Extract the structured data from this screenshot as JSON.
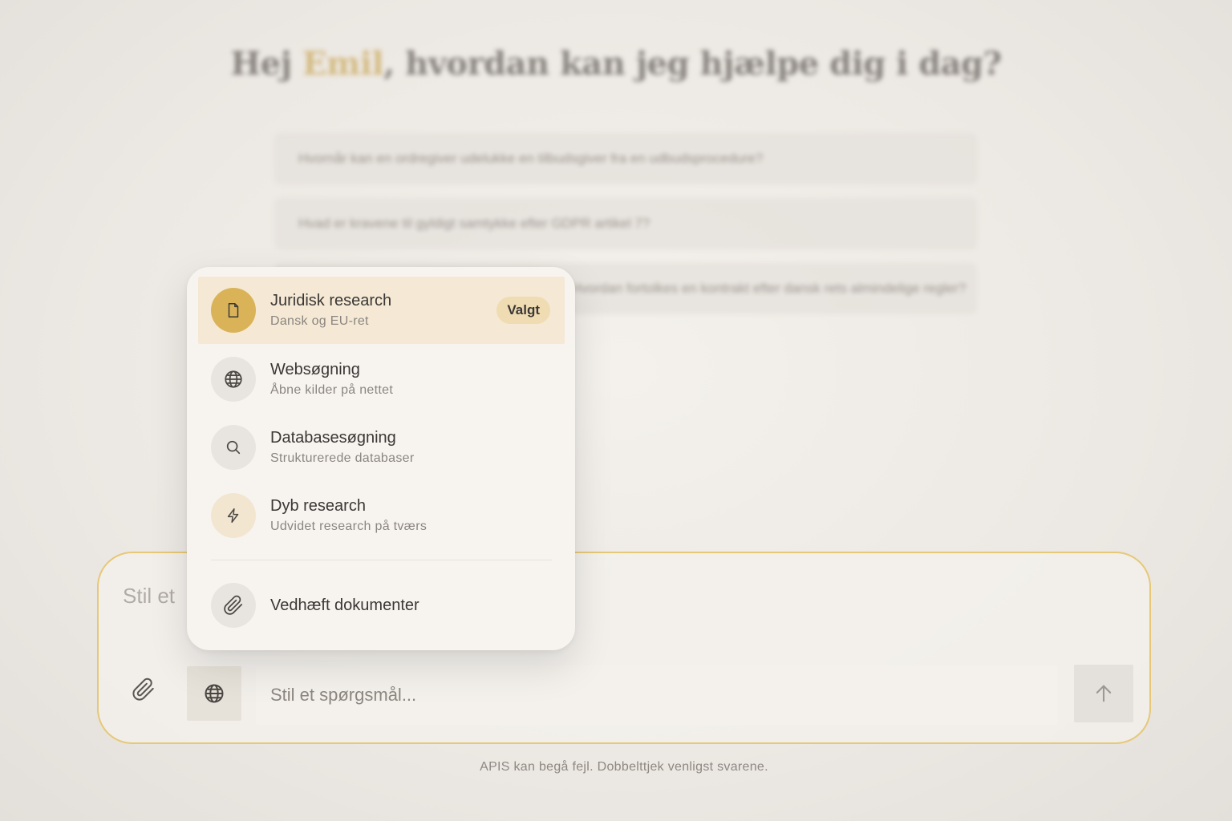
{
  "background": {
    "greeting_prefix": "Hej ",
    "greeting_name": "Emil",
    "greeting_suffix": ", hvordan kan jeg hjælpe dig i dag?",
    "suggestions": [
      "Hvornår kan en ordregiver udelukke en tilbudsgiver fra en udbudsprocedure?",
      "Hvad er kravene til gyldigt samtykke efter GDPR artikel 7?",
      "Hvordan fortolkes en kontrakt efter dansk rets almindelige regler?"
    ]
  },
  "menu": {
    "items": [
      {
        "title": "Juridisk research",
        "subtitle": "Dansk og EU-ret",
        "icon": "document-icon",
        "badge": "Valgt"
      },
      {
        "title": "Websøgning",
        "subtitle": "Åbne kilder på nettet",
        "icon": "globe-icon"
      },
      {
        "title": "Databasesøgning",
        "subtitle": "Strukturerede databaser",
        "icon": "search-icon"
      },
      {
        "title": "Dyb research",
        "subtitle": "Udvidet research på tværs",
        "icon": "lightning-icon"
      }
    ],
    "attach_label": "Vedhæft dokumenter"
  },
  "composer": {
    "placeholder_top": "Stil et",
    "input_placeholder": "Stil et spørgsmål..."
  },
  "disclaimer": "APIS kan begå fejl. Dobbelttjek venligst svarene.",
  "colors": {
    "accent_gold": "#dab359",
    "selected_bg": "#f5e9d5",
    "composer_border": "#e6c876"
  }
}
